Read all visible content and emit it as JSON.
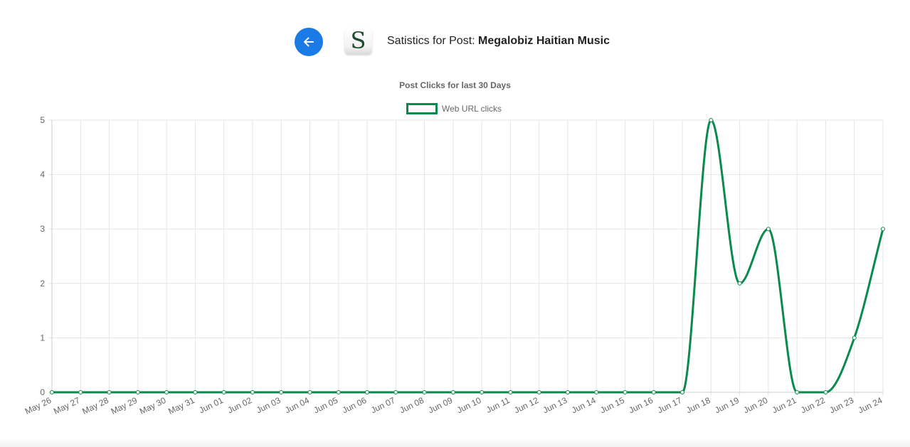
{
  "header": {
    "back_icon": "arrow-left-icon",
    "logo_letter": "S",
    "title_prefix": "Satistics for Post:",
    "post_name": "Megalobiz Haitian Music"
  },
  "colors": {
    "accent": "#1a7ae6",
    "series": "#0a8a4c",
    "grid": "#e5e5e5",
    "axis_text": "#666666"
  },
  "chart_data": {
    "type": "line",
    "title": "Post Clicks for last 30 Days",
    "legend_position": "top-center",
    "grid": true,
    "categories": [
      "May 26",
      "May 27",
      "May 28",
      "May 29",
      "May 30",
      "May 31",
      "Jun 01",
      "Jun 02",
      "Jun 03",
      "Jun 04",
      "Jun 05",
      "Jun 06",
      "Jun 07",
      "Jun 08",
      "Jun 09",
      "Jun 10",
      "Jun 11",
      "Jun 12",
      "Jun 13",
      "Jun 14",
      "Jun 15",
      "Jun 16",
      "Jun 17",
      "Jun 18",
      "Jun 19",
      "Jun 20",
      "Jun 21",
      "Jun 22",
      "Jun 23",
      "Jun 24"
    ],
    "series": [
      {
        "name": "Web URL clicks",
        "values": [
          0,
          0,
          0,
          0,
          0,
          0,
          0,
          0,
          0,
          0,
          0,
          0,
          0,
          0,
          0,
          0,
          0,
          0,
          0,
          0,
          0,
          0,
          0,
          5,
          2,
          3,
          0,
          0,
          1,
          3
        ]
      }
    ],
    "ylim": [
      0,
      5
    ],
    "yticks": [
      "0",
      "1",
      "2",
      "3",
      "4",
      "5"
    ]
  }
}
